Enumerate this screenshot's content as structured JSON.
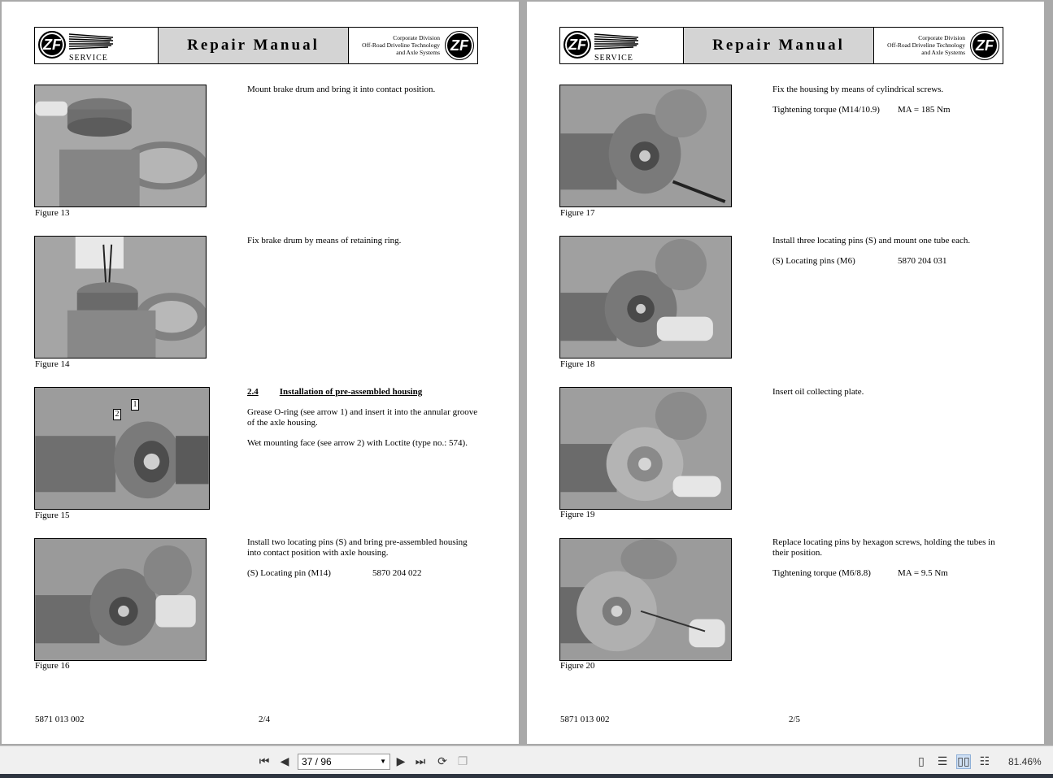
{
  "header": {
    "logo_text": "ZF",
    "service_label": "SERVICE",
    "title": "Repair Manual",
    "corp_line1": "Corporate Division",
    "corp_line2": "Off-Road Driveline Technology",
    "corp_line3": "and Axle Systems"
  },
  "left_page": {
    "figures": [
      {
        "caption": "Figure 13",
        "text": [
          "Mount brake drum and bring it into contact position."
        ]
      },
      {
        "caption": "Figure 14",
        "text": [
          "Fix brake drum by means of retaining ring."
        ]
      },
      {
        "caption": "Figure 15",
        "section_no": "2.4",
        "section_title": "Installation of pre-assembled housing",
        "text": [
          "Grease O-ring (see arrow 1) and insert it into the annular groove of the axle housing.",
          "Wet mounting face (see arrow 2) with Loctite (type no.: 574)."
        ],
        "callout1": "1",
        "callout2": "2"
      },
      {
        "caption": "Figure 16",
        "text": [
          "Install two locating pins (S) and bring pre-assembled housing into contact position with axle housing."
        ],
        "spec_label": "(S) Locating pin (M14)",
        "spec_value": "5870 204 022"
      }
    ],
    "doc_no": "5871 013 002",
    "page_no": "2/4"
  },
  "right_page": {
    "figures": [
      {
        "caption": "Figure 17",
        "text": [
          "Fix the housing by means of cylindrical screws."
        ],
        "spec_label": "Tightening torque (M14/10.9)",
        "spec_value": "MA = 185 Nm"
      },
      {
        "caption": "Figure 18",
        "text": [
          "Install three locating pins (S) and mount one tube each."
        ],
        "spec_label": "(S) Locating pins (M6)",
        "spec_value": "5870 204 031"
      },
      {
        "caption": "Figure 19",
        "text": [
          "Insert oil collecting plate."
        ]
      },
      {
        "caption": "Figure 20",
        "text": [
          "Replace locating pins by hexagon screws, holding the tubes in their position."
        ],
        "spec_label": "Tightening torque (M6/8.8)",
        "spec_value": "MA = 9.5 Nm"
      }
    ],
    "doc_no": "5871 013 002",
    "page_no": "2/5"
  },
  "toolbar": {
    "page_indicator": "37 / 96",
    "zoom": "81.46%",
    "icons": [
      "first-page-icon",
      "prev-page-icon",
      "next-page-icon",
      "last-page-icon",
      "rotate-icon",
      "copy-icon",
      "single-page-icon",
      "continuous-icon",
      "two-page-icon",
      "two-page-continuous-icon"
    ]
  }
}
